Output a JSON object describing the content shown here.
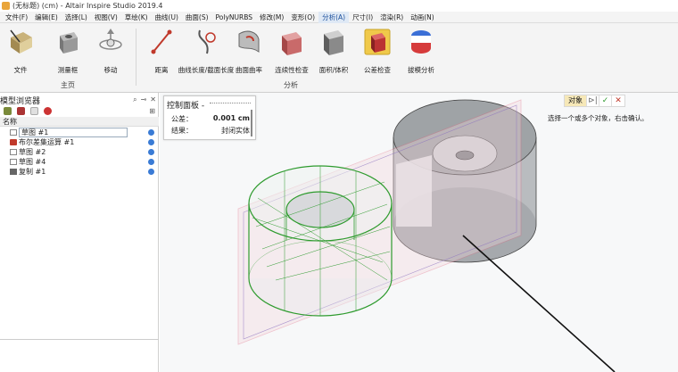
{
  "window": {
    "title": "(无标题) (cm) - Altair Inspire Studio 2019.4"
  },
  "menu": [
    {
      "label": "文件(F)",
      "active": false
    },
    {
      "label": "编辑(E)",
      "active": false
    },
    {
      "label": "选择(L)",
      "active": false
    },
    {
      "label": "视图(V)",
      "active": false
    },
    {
      "label": "草绘(K)",
      "active": false
    },
    {
      "label": "曲线(U)",
      "active": false
    },
    {
      "label": "曲面(S)",
      "active": false
    },
    {
      "label": "PolyNURBS",
      "active": false
    },
    {
      "label": "修改(M)",
      "active": false
    },
    {
      "label": "变形(O)",
      "active": false
    },
    {
      "label": "分析(A)",
      "active": true
    },
    {
      "label": "尺寸(I)",
      "active": false
    },
    {
      "label": "渲染(R)",
      "active": false
    },
    {
      "label": "动画(N)",
      "active": false
    }
  ],
  "ribbon": {
    "home_group": "主页",
    "analysis_group": "分析",
    "tools": {
      "file": "文件",
      "ruler": "测量框",
      "move": "移动",
      "distance": "距离",
      "curve_length": "曲线长度/截面长度",
      "curvature": "曲面曲率",
      "continuity": "连续性检查",
      "area_volume": "面积/体积",
      "tolerance": "公差检查",
      "draft": "拔模分析"
    }
  },
  "browser": {
    "title": "模型浏览器",
    "column_name": "名称",
    "items": [
      {
        "label": "草图 #1",
        "kind": "sketch",
        "selected": true
      },
      {
        "label": "布尔差集运算 #1",
        "kind": "bool",
        "selected": false
      },
      {
        "label": "草图 #2",
        "kind": "sketch",
        "selected": false
      },
      {
        "label": "草图 #4",
        "kind": "sketch",
        "selected": false
      },
      {
        "label": "复制 #1",
        "kind": "copy",
        "selected": false
      }
    ]
  },
  "control_panel": {
    "title": "控制面板 -",
    "tolerance_label": "公差：",
    "tolerance_value": "0.001 cm",
    "result_label": "结果：",
    "result_value": "封闭实体"
  },
  "selector": {
    "object_label": "对象",
    "hint": "选择一个或多个对象，右击确认。"
  },
  "colors": {
    "accent": "#3a7bd5",
    "wire_green": "#2e9b2e",
    "plane_pink": "#e0607a",
    "solid_gray": "#b9bcbf"
  }
}
